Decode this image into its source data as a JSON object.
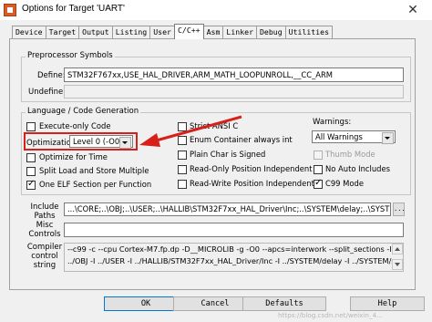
{
  "window": {
    "title": "Options for Target 'UART'",
    "close_glyph": "✕"
  },
  "tabs": [
    {
      "label": "Device"
    },
    {
      "label": "Target"
    },
    {
      "label": "Output"
    },
    {
      "label": "Listing"
    },
    {
      "label": "User"
    },
    {
      "label": "C/C++"
    },
    {
      "label": "Asm"
    },
    {
      "label": "Linker"
    },
    {
      "label": "Debug"
    },
    {
      "label": "Utilities"
    }
  ],
  "active_tab": "C/C++",
  "preprocessor": {
    "legend": "Preprocessor Symbols",
    "define_label": "Define:",
    "define_value": "STM32F767xx,USE_HAL_DRIVER,ARM_MATH_LOOPUNROLL,__CC_ARM",
    "undefine_label": "Undefine:",
    "undefine_value": ""
  },
  "language": {
    "legend": "Language / Code Generation",
    "execute_only": {
      "label": "Execute-only Code",
      "checked": false
    },
    "optimization_label": "Optimization:",
    "optimization_value": "Level 0 (-O0)",
    "optimize_time": {
      "label": "Optimize for Time",
      "checked": false
    },
    "split_load": {
      "label": "Split Load and Store Multiple",
      "checked": false
    },
    "one_elf": {
      "label": "One ELF Section per Function",
      "checked": true
    },
    "strict_ansi": {
      "label": "Strict ANSI C",
      "checked": false
    },
    "enum_container": {
      "label": "Enum Container always int",
      "checked": false
    },
    "plain_char": {
      "label": "Plain Char is Signed",
      "checked": false
    },
    "ro_pi": {
      "label": "Read-Only Position Independent",
      "checked": false
    },
    "rw_pi": {
      "label": "Read-Write Position Independent",
      "checked": false
    },
    "warnings_label": "Warnings:",
    "warnings_value": "All Warnings",
    "thumb_mode": {
      "label": "Thumb Mode",
      "checked": false,
      "disabled": true
    },
    "no_auto_includes": {
      "label": "No Auto Includes",
      "checked": false
    },
    "c99_mode": {
      "label": "C99 Mode",
      "checked": true
    }
  },
  "include": {
    "label_line1": "Include",
    "label_line2": "Paths",
    "value": "...\\CORE;..\\OBJ;..\\USER;..\\HALLIB\\STM32F7xx_HAL_Driver\\Inc;..\\SYSTEM\\delay;..\\SYSTEM\\sys",
    "browse_label": "..."
  },
  "misc": {
    "label_line1": "Misc",
    "label_line2": "Controls",
    "value": ""
  },
  "compiler": {
    "label_line1": "Compiler",
    "label_line2": "control",
    "label_line3": "string",
    "line1": "--c99 -c --cpu Cortex-M7.fp.dp -D__MICROLIB -g -O0 --apcs=interwork --split_sections -I ../CORE -I",
    "line2": "../OBJ -I ../USER -I ../HALLIB/STM32F7xx_HAL_Driver/Inc -I ../SYSTEM/delay -I ../SYSTEM/sys -I"
  },
  "buttons": {
    "ok": "OK",
    "cancel": "Cancel",
    "defaults": "Defaults",
    "help": "Help"
  },
  "watermark": "https://blog.csdn.net/weixin_4..."
}
